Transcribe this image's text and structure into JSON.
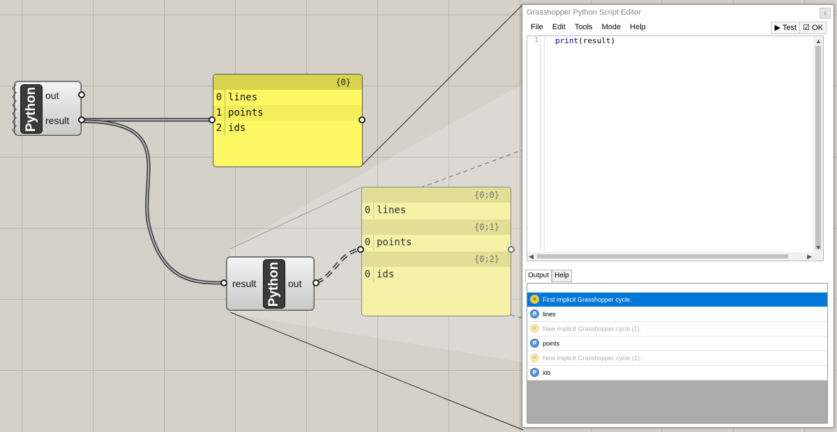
{
  "canvas": {
    "python_comp_1": {
      "badge": "Python",
      "outputs": [
        "out",
        "result"
      ]
    },
    "panel_main": {
      "path": "{0}",
      "rows": [
        {
          "index": "0",
          "value": "lines"
        },
        {
          "index": "1",
          "value": "points"
        },
        {
          "index": "2",
          "value": "ids"
        }
      ]
    },
    "python_comp_2": {
      "badge": "Python",
      "input": "result",
      "output": "out"
    },
    "panel_tree": {
      "branches": [
        {
          "path": "{0;0}",
          "index": "0",
          "value": "lines"
        },
        {
          "path": "{0;1}",
          "index": "0",
          "value": "points"
        },
        {
          "path": "{0;2}",
          "index": "0",
          "value": "ids"
        }
      ]
    }
  },
  "editor": {
    "title": "Grasshopper Python Script Editor",
    "close_glyph": "x",
    "menu": [
      "File",
      "Edit",
      "Tools",
      "Mode",
      "Help"
    ],
    "test_label": "Test",
    "ok_label": "OK",
    "code": {
      "line_number": "1",
      "keyword": "print",
      "rest": "(result)"
    },
    "tabs": [
      "Output",
      "Help"
    ],
    "output": [
      {
        "icon": "sun-icon",
        "text": "First implicit Grasshopper cycle.",
        "state": "selected"
      },
      {
        "icon": "python-icon",
        "text": "lines",
        "state": "normal"
      },
      {
        "icon": "sun-icon",
        "text": "New implicit Grasshopper cycle (1).",
        "state": "dim"
      },
      {
        "icon": "python-icon",
        "text": "points",
        "state": "normal"
      },
      {
        "icon": "sun-icon",
        "text": "New implicit Grasshopper cycle (2).",
        "state": "dim"
      },
      {
        "icon": "python-icon",
        "text": "ids",
        "state": "normal"
      }
    ]
  },
  "colors": {
    "canvas": "#d5d1c9",
    "panel_yellow": "#fdf964",
    "selection_blue": "#0078d7"
  }
}
